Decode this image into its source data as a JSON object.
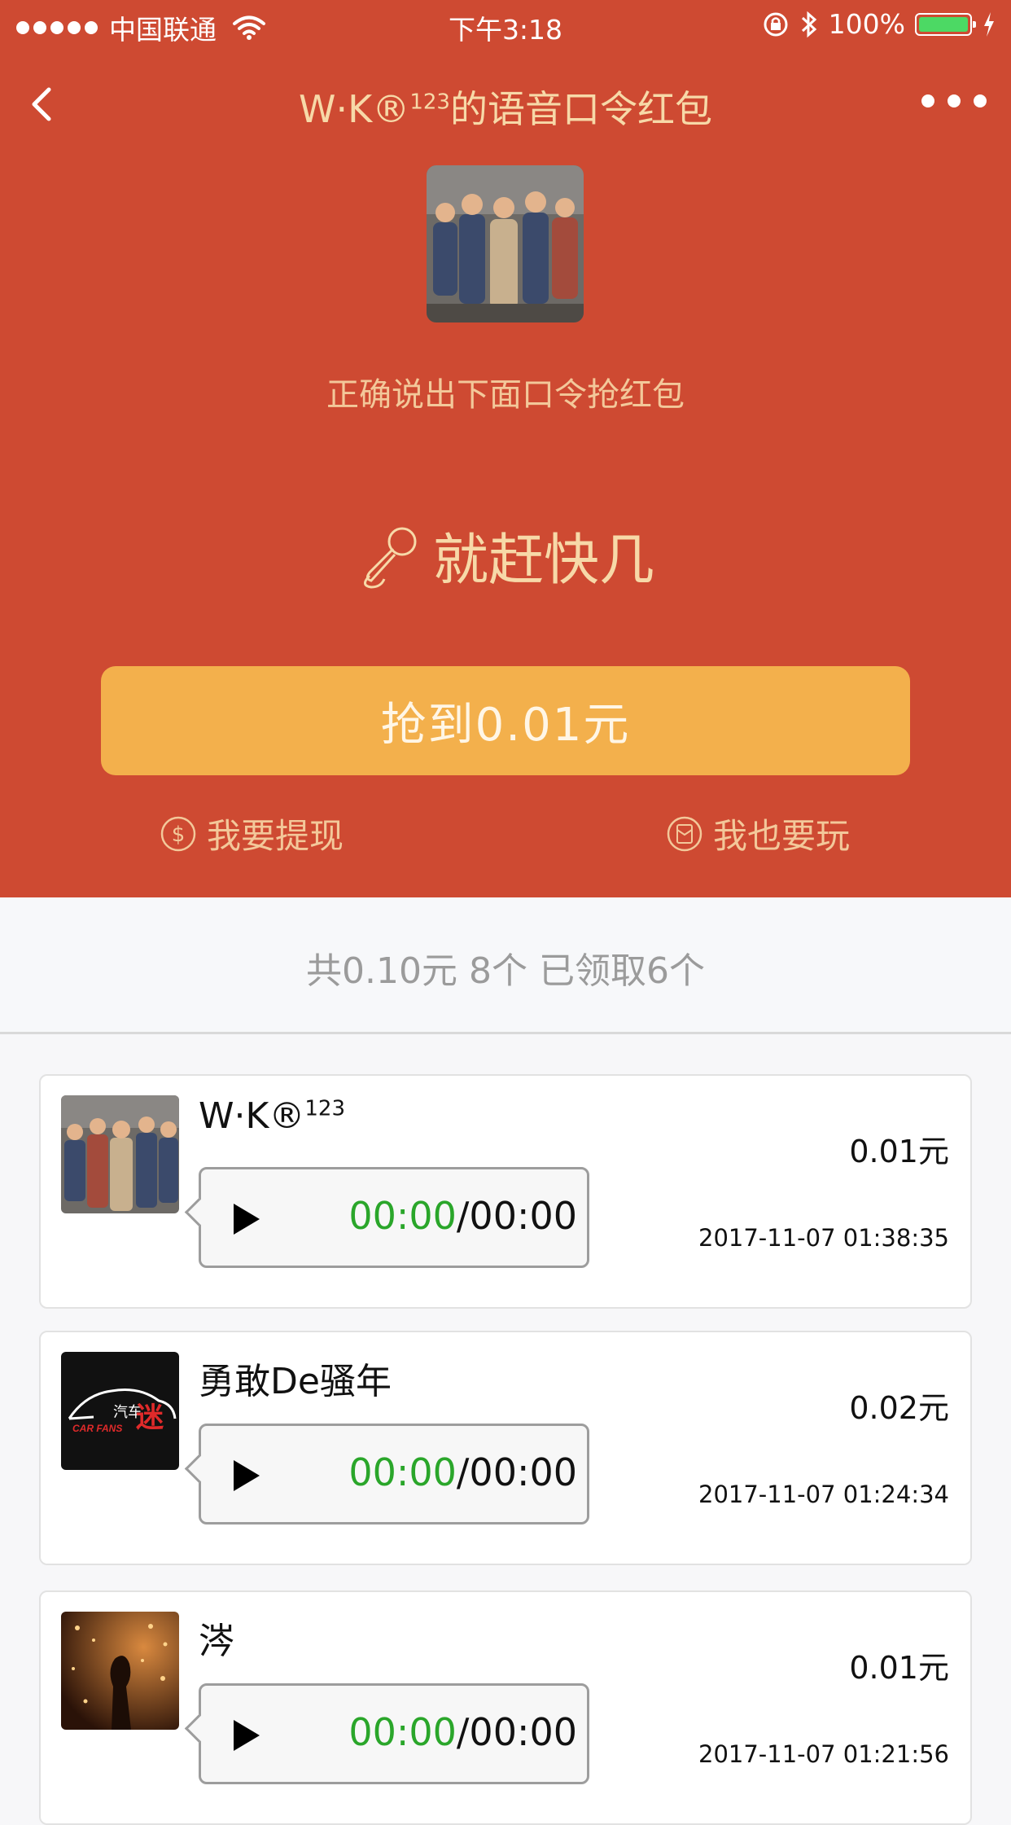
{
  "status_bar": {
    "carrier": "中国联通",
    "time": "下午3:18",
    "battery": "100%",
    "battery_level": 1.0
  },
  "nav": {
    "title_prefix": "W·K®",
    "title_sup": "123",
    "title_suffix": "的语音口令红包"
  },
  "packet": {
    "tip": "正确说出下面口令抢红包",
    "phrase": "就赶快几",
    "grab_button": "抢到0.01元",
    "withdraw": "我要提现",
    "play_too": "我也要玩"
  },
  "summary": "共0.10元 8个 已领取6个",
  "records": [
    {
      "name": "W·K®",
      "name_sup": "123",
      "current": "00:00",
      "duration": "00:00",
      "amount": "0.01元",
      "timestamp": "2017-11-07 01:38:35"
    },
    {
      "name": "勇敢De骚年",
      "name_sup": "",
      "current": "00:00",
      "duration": "00:00",
      "amount": "0.02元",
      "timestamp": "2017-11-07 01:24:34",
      "avatar_logo_top": "汽车",
      "avatar_logo_big": "迷",
      "avatar_logo_sub": "CAR FANS"
    },
    {
      "name": "涔",
      "name_sup": "",
      "current": "00:00",
      "duration": "00:00",
      "amount": "0.01元",
      "timestamp": "2017-11-07 01:21:56"
    }
  ],
  "colors": {
    "header_bg": "#ce4a32",
    "button_bg": "#f3b04c",
    "gold_text": "#f7d9a8",
    "time_current": "#2aa62a"
  },
  "icons": [
    "back-chevron-icon",
    "more-dots-icon",
    "microphone-icon",
    "dollar-coin-icon",
    "red-packet-icon",
    "play-icon",
    "wifi-icon",
    "lock-rotation-icon",
    "bluetooth-icon",
    "charging-icon"
  ]
}
